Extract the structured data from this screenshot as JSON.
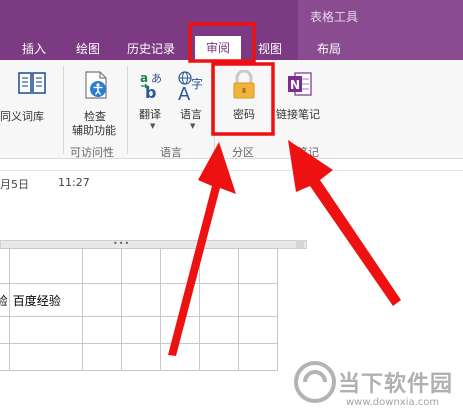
{
  "app": {
    "context_tab_group": "表格工具"
  },
  "tabs": [
    {
      "label": "插入",
      "active": false
    },
    {
      "label": "绘图",
      "active": false
    },
    {
      "label": "历史记录",
      "active": false
    },
    {
      "label": "审阅",
      "active": true
    },
    {
      "label": "视图",
      "active": false
    },
    {
      "label": "布局",
      "active": false
    }
  ],
  "ribbon": {
    "thesaurus_label": "同义词库",
    "accessibility_label_1": "检查",
    "accessibility_label_2": "辅助功能",
    "translate_label": "翻译",
    "language_label": "语言",
    "password_label": "密码",
    "link_notes_label": "链接笔记",
    "groups": {
      "accessibility": "可访问性",
      "language": "语言",
      "section": "分区",
      "notes_fragment": "笔记"
    },
    "icons": {
      "thesaurus": "book-icon",
      "accessibility": "accessibility-check-icon",
      "translate": "translate-icon",
      "language": "language-icon",
      "password": "lock-icon",
      "link_notes": "onenote-icon"
    }
  },
  "page": {
    "date_fragment": "月5日",
    "time": "11:27",
    "table_cell_fragment": "验",
    "table_cell_text": "百度经验"
  },
  "watermark": {
    "text": "当下软件园",
    "url": "www.downxia.com"
  },
  "colors": {
    "tab_bar": "#7b3a82",
    "context_tab_header": "#8a4b91",
    "annotation": "#ee1111",
    "lock_body": "#f0b43c",
    "onenote": "#7b2f8e"
  }
}
